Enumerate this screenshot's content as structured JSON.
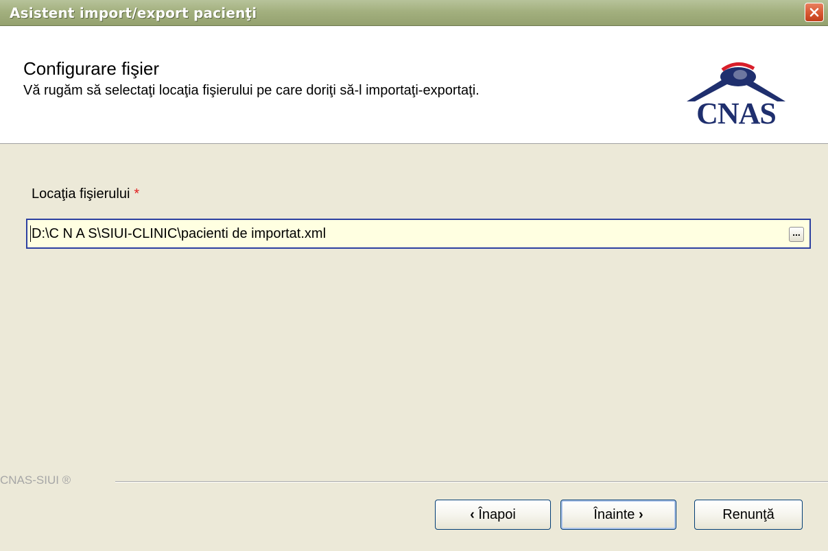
{
  "window": {
    "title": "Asistent import/export pacienţi",
    "close_icon": "close-icon"
  },
  "header": {
    "title": "Configurare fişier",
    "subtitle": "Vă rugăm să selectaţi locaţia fişierului pe care doriţi să-l importaţi-exportaţi.",
    "logo_text": "CNAS"
  },
  "form": {
    "file_label": "Locaţia fişierului",
    "required_marker": "*",
    "file_value": "D:\\C N A S\\SIUI-CLINIC\\pacienti de importat.xml",
    "browse_label": "..."
  },
  "footer": {
    "brand": "CNAS-SIUI ®",
    "back_label": "Înapoi",
    "next_label": "Înainte",
    "cancel_label": "Renunţă"
  },
  "colors": {
    "titlebar": "#A3B07F",
    "dialog_bg": "#ECE9D8",
    "input_bg": "#FFFFE1",
    "input_border": "#2B3FA0",
    "required": "#E02020",
    "logo": "#1F2F6E"
  }
}
